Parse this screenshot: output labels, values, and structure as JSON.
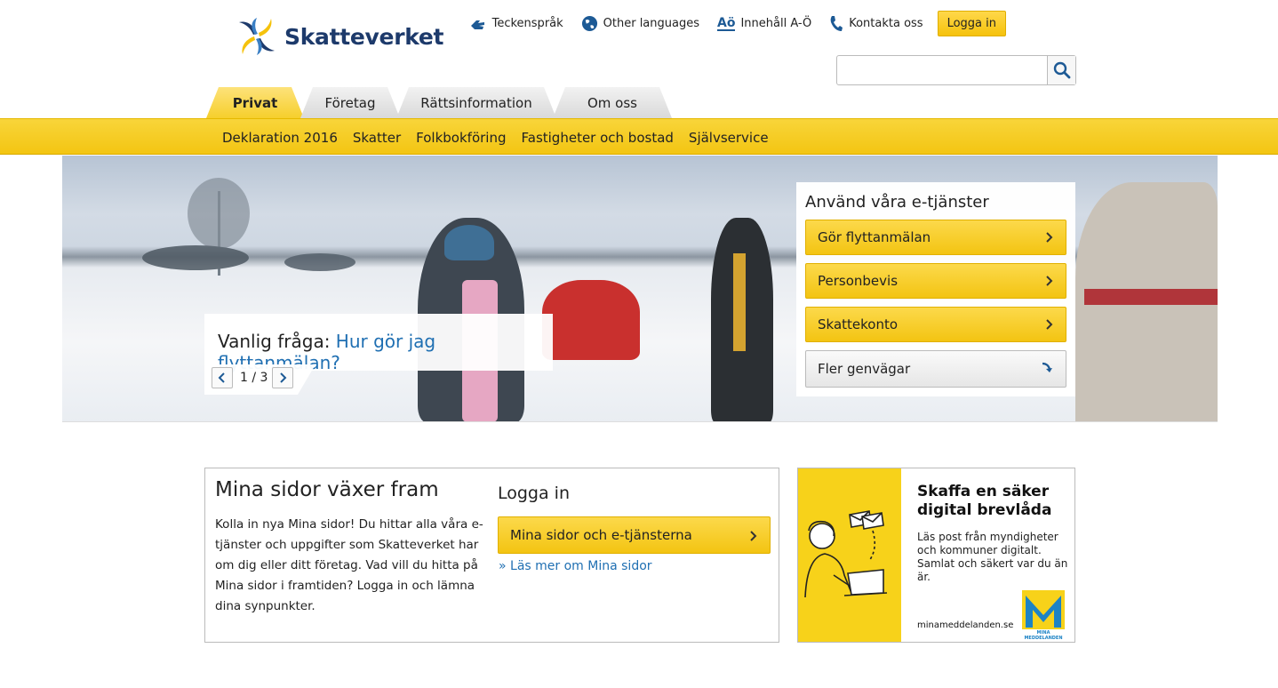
{
  "logo": {
    "text": "Skatteverket"
  },
  "toplinks": [
    {
      "label": "Teckenspråk",
      "icon": "sign-language-icon"
    },
    {
      "label": "Other languages",
      "icon": "globe-icon"
    },
    {
      "label": "Innehåll A-Ö",
      "icon": "a-o-index-icon",
      "icon_text": "Aö"
    },
    {
      "label": "Kontakta oss",
      "icon": "phone-icon"
    }
  ],
  "login_button": "Logga in",
  "search": {
    "placeholder": "",
    "value": ""
  },
  "tabs": [
    {
      "label": "Privat",
      "active": true
    },
    {
      "label": "Företag"
    },
    {
      "label": "Rättsinformation"
    },
    {
      "label": "Om oss"
    }
  ],
  "subnav": [
    "Deklaration 2016",
    "Skatter",
    "Folkbokföring",
    "Fastigheter och bostad",
    "Självservice"
  ],
  "hero": {
    "question_prefix": "Vanlig fråga:",
    "question_link": "Hur gör jag flyttanmälan?",
    "slide_counter": "1 / 3"
  },
  "etjanster": {
    "title": "Använd våra e-tjänster",
    "buttons": [
      "Gör flyttanmälan",
      "Personbevis",
      "Skattekonto"
    ],
    "more": "Fler genvägar"
  },
  "mina": {
    "title": "Mina sidor växer fram",
    "body": "Kolla in nya Mina sidor! Du hittar alla våra e-tjänster och uppgifter som Skatteverket har om dig eller ditt företag. Vad vill du hitta på Mina sidor i framtiden? Logga in och lämna dina synpunkter.",
    "login_title": "Logga in",
    "login_button": "Mina sidor och e-tjänsterna",
    "read_more": "Läs mer om Mina sidor",
    "read_more_prefix": "»"
  },
  "ad": {
    "title": "Skaffa en säker digital brevlåda",
    "body": "Läs post från myndigheter och kommuner digitalt. Samlat och säkert var du än är.",
    "url": "minameddelanden.se",
    "logo_caption": "MINA MEDDELANDEN"
  },
  "colors": {
    "brand_yellow": "#f5c20c",
    "brand_blue": "#1d3a6b",
    "link_blue": "#1f6fb2"
  }
}
